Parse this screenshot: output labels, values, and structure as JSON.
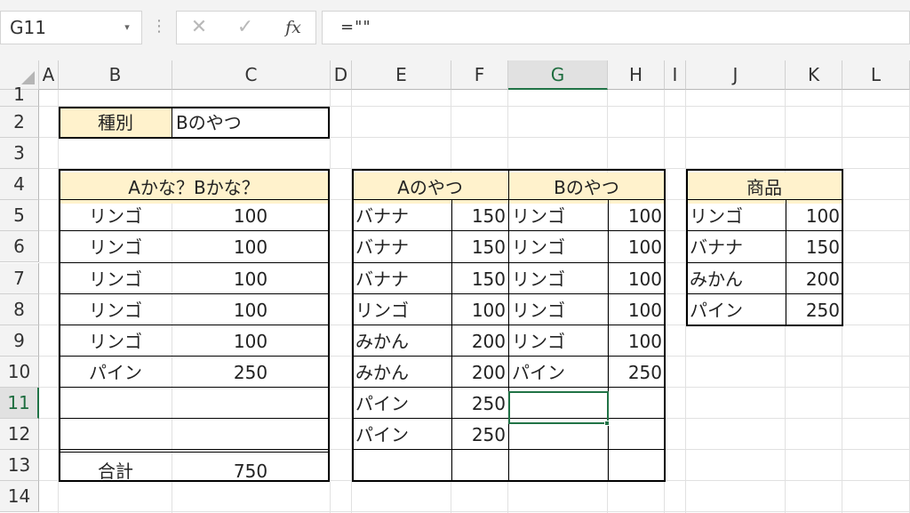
{
  "formula_bar": {
    "name_box": "G11",
    "formula": "=\"\"",
    "cancel_icon": "✕",
    "enter_icon": "✓",
    "fx_label": "fx"
  },
  "columns": [
    "A",
    "B",
    "C",
    "D",
    "E",
    "F",
    "G",
    "H",
    "I",
    "J",
    "K",
    "L"
  ],
  "selected_column": "G",
  "rows": [
    "1",
    "2",
    "3",
    "4",
    "5",
    "6",
    "7",
    "8",
    "9",
    "10",
    "11",
    "12",
    "13",
    "14"
  ],
  "selected_row": "11",
  "type_box": {
    "label": "種別",
    "value": "Bのやつ"
  },
  "result_table": {
    "header": "Aかな？Bかな？",
    "rows": [
      {
        "name": "リンゴ",
        "price": "100"
      },
      {
        "name": "リンゴ",
        "price": "100"
      },
      {
        "name": "リンゴ",
        "price": "100"
      },
      {
        "name": "リンゴ",
        "price": "100"
      },
      {
        "name": "リンゴ",
        "price": "100"
      },
      {
        "name": "パイン",
        "price": "250"
      },
      {
        "name": "",
        "price": ""
      },
      {
        "name": "",
        "price": ""
      }
    ],
    "total_label": "合計",
    "total_value": "750"
  },
  "ab_table": {
    "a_header": "Aのやつ",
    "b_header": "Bのやつ",
    "rows": [
      {
        "a_name": "バナナ",
        "a_price": "150",
        "b_name": "リンゴ",
        "b_price": "100"
      },
      {
        "a_name": "バナナ",
        "a_price": "150",
        "b_name": "リンゴ",
        "b_price": "100"
      },
      {
        "a_name": "バナナ",
        "a_price": "150",
        "b_name": "リンゴ",
        "b_price": "100"
      },
      {
        "a_name": "リンゴ",
        "a_price": "100",
        "b_name": "リンゴ",
        "b_price": "100"
      },
      {
        "a_name": "みかん",
        "a_price": "200",
        "b_name": "リンゴ",
        "b_price": "100"
      },
      {
        "a_name": "みかん",
        "a_price": "200",
        "b_name": "パイン",
        "b_price": "250"
      },
      {
        "a_name": "パイン",
        "a_price": "250",
        "b_name": "",
        "b_price": ""
      },
      {
        "a_name": "パイン",
        "a_price": "250",
        "b_name": "",
        "b_price": ""
      },
      {
        "a_name": "",
        "a_price": "",
        "b_name": "",
        "b_price": ""
      }
    ]
  },
  "product_table": {
    "header": "商品",
    "rows": [
      {
        "name": "リンゴ",
        "price": "100"
      },
      {
        "name": "バナナ",
        "price": "150"
      },
      {
        "name": "みかん",
        "price": "200"
      },
      {
        "name": "パイン",
        "price": "250"
      }
    ]
  },
  "colors": {
    "header_fill": "#fff2cc",
    "selection": "#217346",
    "grid": "#e1e1e1"
  }
}
